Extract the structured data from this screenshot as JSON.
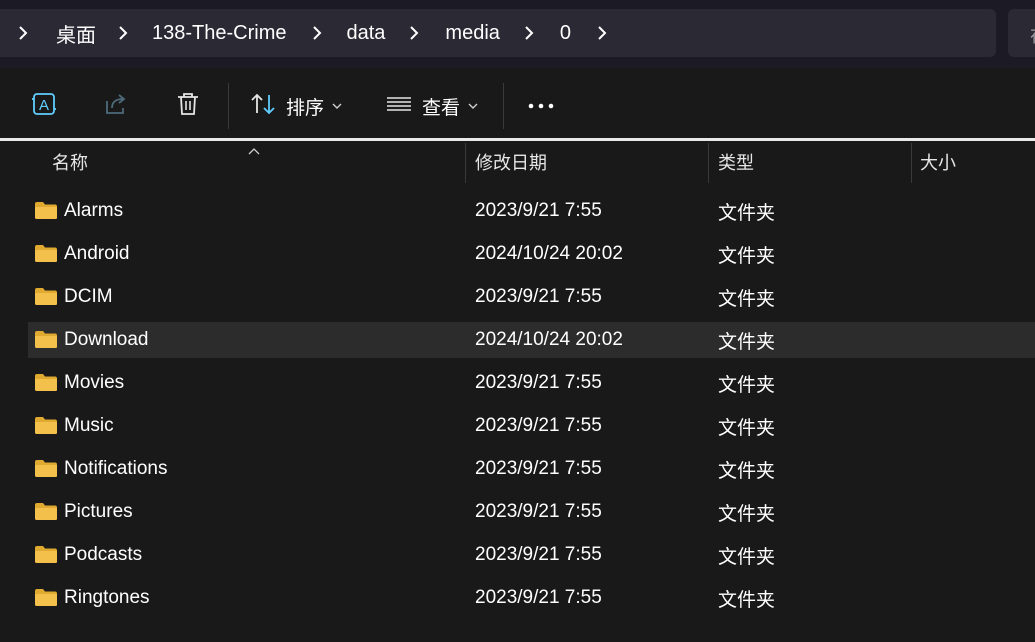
{
  "breadcrumb": {
    "items": [
      "桌面",
      "138-The-Crime",
      "data",
      "media",
      "0"
    ]
  },
  "search_stub": "在",
  "toolbar": {
    "sort_label": "排序",
    "view_label": "查看"
  },
  "columns": {
    "name": "名称",
    "date": "修改日期",
    "type": "类型",
    "size": "大小"
  },
  "files": [
    {
      "name": "Alarms",
      "date": "2023/9/21 7:55",
      "type": "文件夹"
    },
    {
      "name": "Android",
      "date": "2024/10/24 20:02",
      "type": "文件夹"
    },
    {
      "name": "DCIM",
      "date": "2023/9/21 7:55",
      "type": "文件夹"
    },
    {
      "name": "Download",
      "date": "2024/10/24 20:02",
      "type": "文件夹"
    },
    {
      "name": "Movies",
      "date": "2023/9/21 7:55",
      "type": "文件夹"
    },
    {
      "name": "Music",
      "date": "2023/9/21 7:55",
      "type": "文件夹"
    },
    {
      "name": "Notifications",
      "date": "2023/9/21 7:55",
      "type": "文件夹"
    },
    {
      "name": "Pictures",
      "date": "2023/9/21 7:55",
      "type": "文件夹"
    },
    {
      "name": "Podcasts",
      "date": "2023/9/21 7:55",
      "type": "文件夹"
    },
    {
      "name": "Ringtones",
      "date": "2023/9/21 7:55",
      "type": "文件夹"
    }
  ],
  "selected_row": 3,
  "colors": {
    "accent": "#60cdff",
    "folder": "#f3c14b",
    "selected_row": "#2c2c2c"
  },
  "icons": [
    "chevron-right-icon",
    "translate-icon",
    "share-icon",
    "delete-icon",
    "sort-icon",
    "view-icon",
    "more-icon",
    "folder-icon"
  ]
}
